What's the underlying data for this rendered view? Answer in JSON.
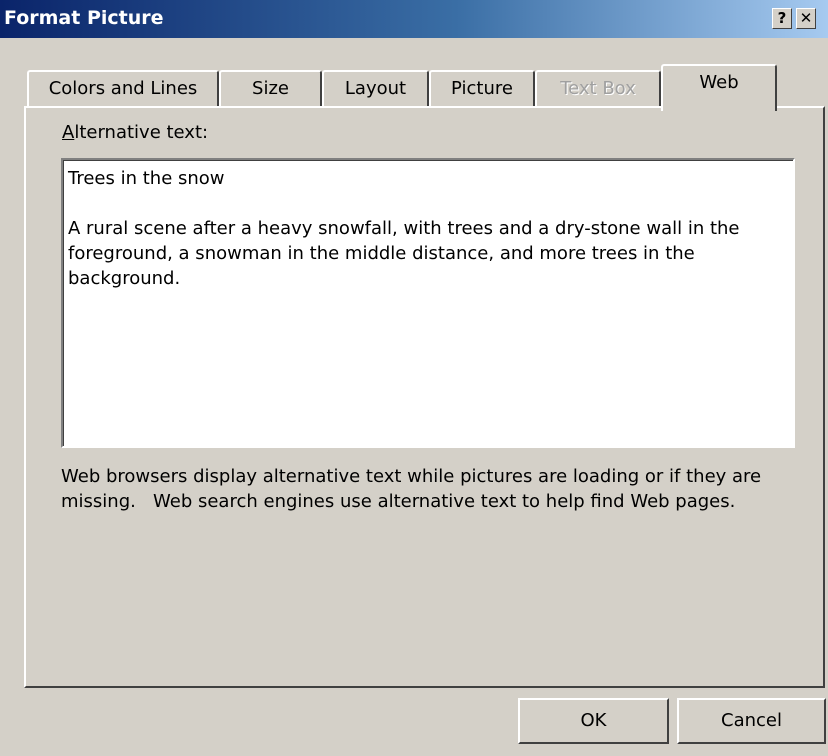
{
  "window": {
    "title": "Format Picture",
    "help_button": "?",
    "close_button": "✕"
  },
  "tabs": [
    {
      "label": "Colors and Lines",
      "state": "normal"
    },
    {
      "label": "Size",
      "state": "normal"
    },
    {
      "label": "Layout",
      "state": "normal"
    },
    {
      "label": "Picture",
      "state": "normal"
    },
    {
      "label": "Text Box",
      "state": "disabled"
    },
    {
      "label": "Web",
      "state": "active"
    }
  ],
  "web": {
    "alt_label_access": "A",
    "alt_label_rest": "lternative text:",
    "alt_text_value": "Trees in the snow\n\nA rural scene after a heavy snowfall, with trees and a dry-stone wall in the foreground, a snowman in the middle distance, and more trees in the background.",
    "help_text": "Web browsers display alternative text while pictures are loading or if they are missing.   Web search engines use alternative text to help find Web pages."
  },
  "buttons": {
    "ok": "OK",
    "cancel": "Cancel"
  }
}
